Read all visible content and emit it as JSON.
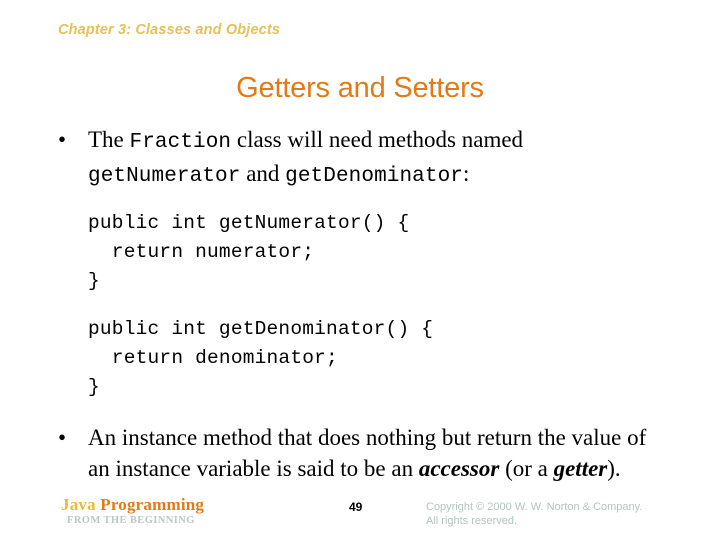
{
  "slide": {
    "chapter_header": "Chapter 3: Classes and Objects",
    "title": "Getters and Setters",
    "colors": {
      "chapter_header": "#e5c158",
      "title": "#e07b18",
      "brand_java": "#e8b93c",
      "brand_programming": "#e07b18",
      "brand_subtitle": "#b9c9c4",
      "copyright": "#b3c4c0",
      "body_text": "#000000",
      "background": "#ffffff"
    }
  },
  "bullets": [
    {
      "marker": "•",
      "parts": [
        {
          "text": "The ",
          "style": "serif"
        },
        {
          "text": "Fraction",
          "style": "mono"
        },
        {
          "text": " class will need methods named ",
          "style": "serif"
        },
        {
          "text": "getNumerator",
          "style": "mono"
        },
        {
          "text": " and ",
          "style": "serif"
        },
        {
          "text": "getDenominator",
          "style": "mono"
        },
        {
          "text": ":",
          "style": "serif"
        }
      ]
    },
    {
      "marker": "•",
      "parts": [
        {
          "text": "An instance method that does nothing but return the value of an instance variable is said to be an ",
          "style": "serif"
        },
        {
          "text": "accessor",
          "style": "serif-bold-italic"
        },
        {
          "text": " (or a ",
          "style": "serif"
        },
        {
          "text": "getter",
          "style": "serif-bold-italic"
        },
        {
          "text": ").",
          "style": "serif"
        }
      ]
    }
  ],
  "code_blocks": [
    {
      "id": "get-numerator",
      "lines": [
        "public int getNumerator() {",
        "  return numerator;",
        "}"
      ],
      "text": "public int getNumerator() {\n  return numerator;\n}"
    },
    {
      "id": "get-denominator",
      "lines": [
        "public int getDenominator() {",
        "  return denominator;",
        "}"
      ],
      "text": "public int getDenominator() {\n  return denominator;\n}"
    }
  ],
  "footer": {
    "brand_word1": "Java ",
    "brand_word2": "Programming",
    "brand_subtitle": "FROM THE BEGINNING",
    "page_number": "49",
    "copyright_line1": "Copyright © 2000 W. W. Norton & Company.",
    "copyright_line2": "All rights reserved."
  }
}
